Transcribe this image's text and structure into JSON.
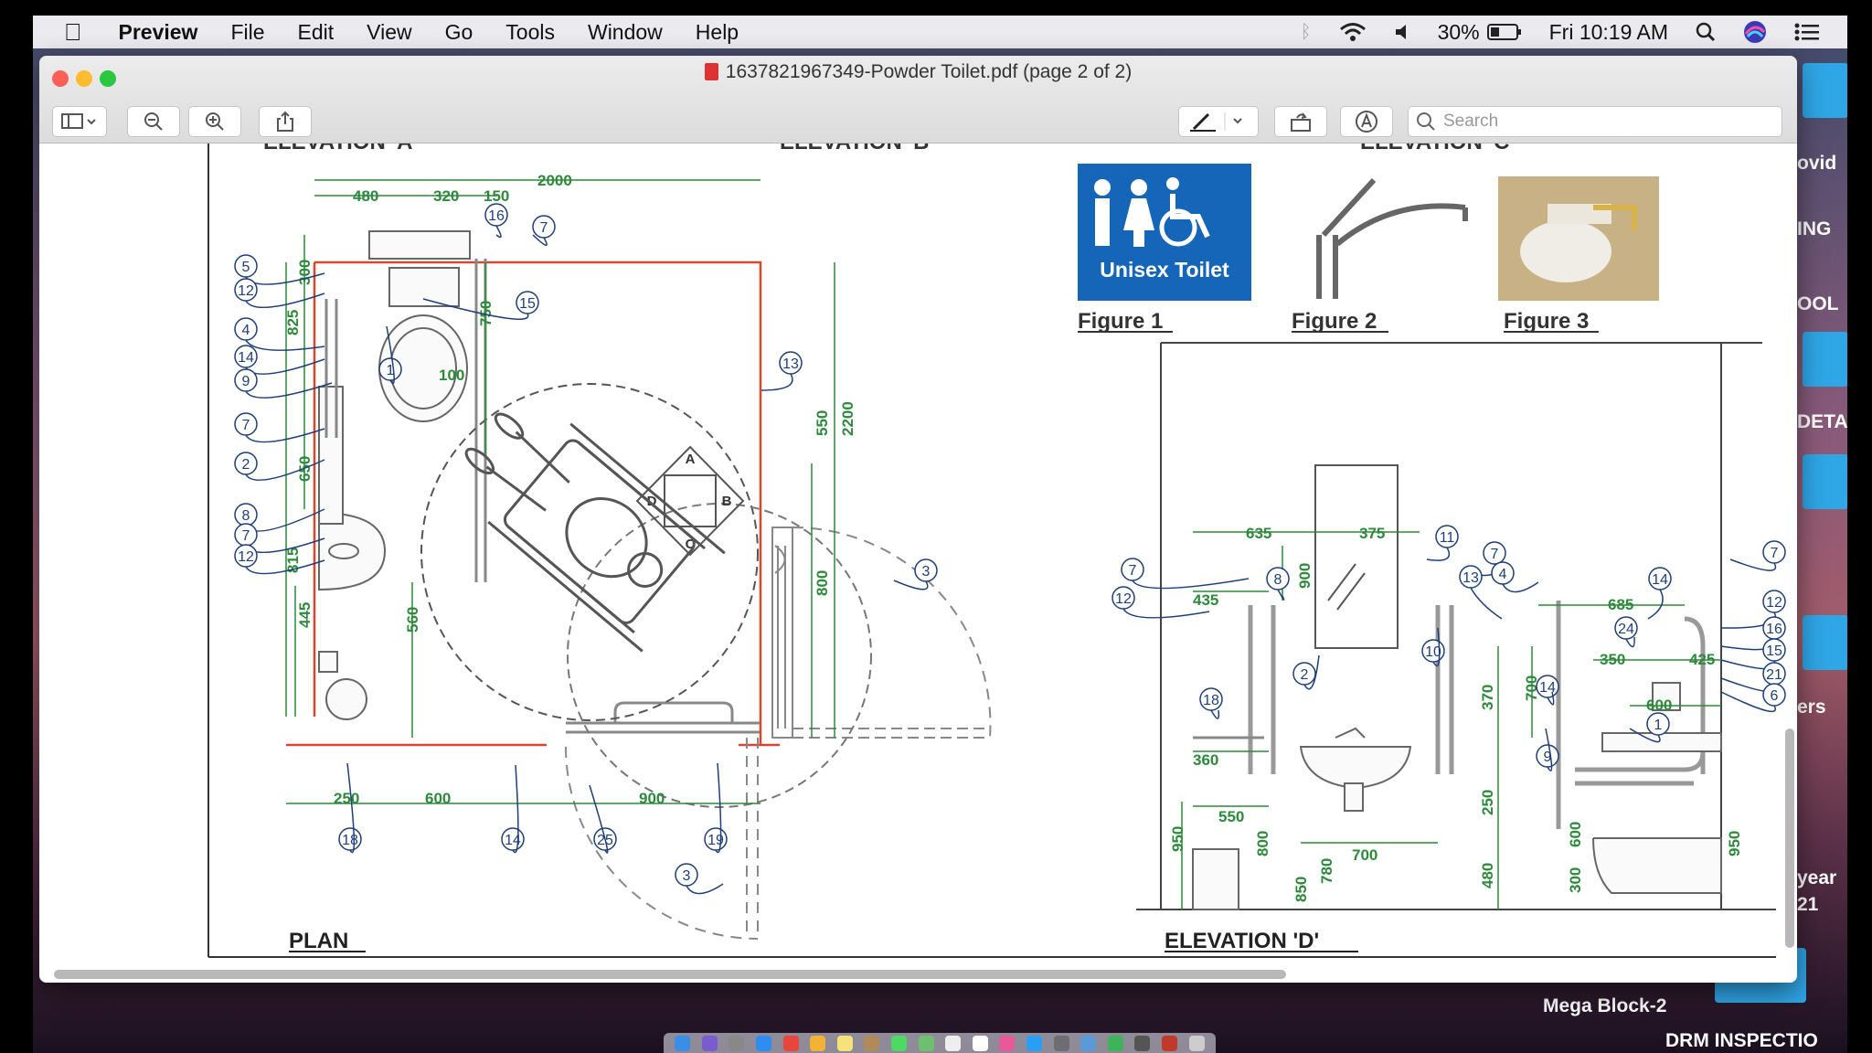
{
  "menubar": {
    "app_name": "Preview",
    "items": [
      "File",
      "Edit",
      "View",
      "Go",
      "Tools",
      "Window",
      "Help"
    ],
    "battery": "30%",
    "clock": "Fri 10:19 AM"
  },
  "window": {
    "title": "1637821967349-Powder Toilet.pdf (page 2 of 2)",
    "search_placeholder": "Search"
  },
  "drawing": {
    "plan_label": "PLAN",
    "elevation_d_label": "ELEVATION 'D'",
    "elevation_a_label": "ELEVATION 'A'",
    "elevation_b_label": "ELEVATION 'B'",
    "elevation_c_label": "ELEVATION 'C'",
    "sign_text": "Unisex Toilet",
    "figure1": "Figure 1",
    "figure2": "Figure 2",
    "figure3": "Figure 3",
    "turning_labels": [
      "A",
      "B",
      "C",
      "D"
    ],
    "plan_dims": {
      "d2000": "2000",
      "d480": "480",
      "d320": "320",
      "d150": "150",
      "d300": "300",
      "d825": "825",
      "d750": "750",
      "d100": "100",
      "d650": "650",
      "d815": "815",
      "d445": "445",
      "d560": "560",
      "d550": "550",
      "d2200": "2200",
      "d800": "800",
      "d250": "250",
      "d600": "600",
      "d900": "900"
    },
    "elev_dims": {
      "d635": "635",
      "d375": "375",
      "d900": "900",
      "d435": "435",
      "d685": "685",
      "d350": "350",
      "d425": "425",
      "d600": "600",
      "d360": "360",
      "d370": "370",
      "d700a": "700",
      "d550": "550",
      "d250": "250",
      "d700": "700",
      "d950": "950",
      "d800": "800",
      "d850": "850",
      "d780": "780",
      "d480": "480",
      "d600v": "600",
      "d300": "300",
      "d950r": "950"
    },
    "plan_callouts": [
      "16",
      "7",
      "5",
      "12",
      "15",
      "4",
      "14",
      "9",
      "1",
      "13",
      "7",
      "2",
      "8",
      "7",
      "12",
      "3",
      "18",
      "14",
      "25",
      "19",
      "3"
    ],
    "elev_callouts": [
      "11",
      "7",
      "7",
      "8",
      "4",
      "7",
      "12",
      "13",
      "14",
      "12",
      "24",
      "16",
      "15",
      "10",
      "2",
      "21",
      "14",
      "6",
      "18",
      "1",
      "9"
    ]
  },
  "desktop": {
    "right_texts": [
      "ovid",
      "ING",
      "OOL",
      "DETA",
      "ers",
      "year",
      "21"
    ],
    "folder_label": "Mega Block-2",
    "bottom_label": "DRM INSPECTIO"
  },
  "colors": {
    "dim_green": "#2c8a3a",
    "callout_blue": "#1f3f7a",
    "wall_red": "#d9452f",
    "sign_blue": "#1565b8"
  }
}
